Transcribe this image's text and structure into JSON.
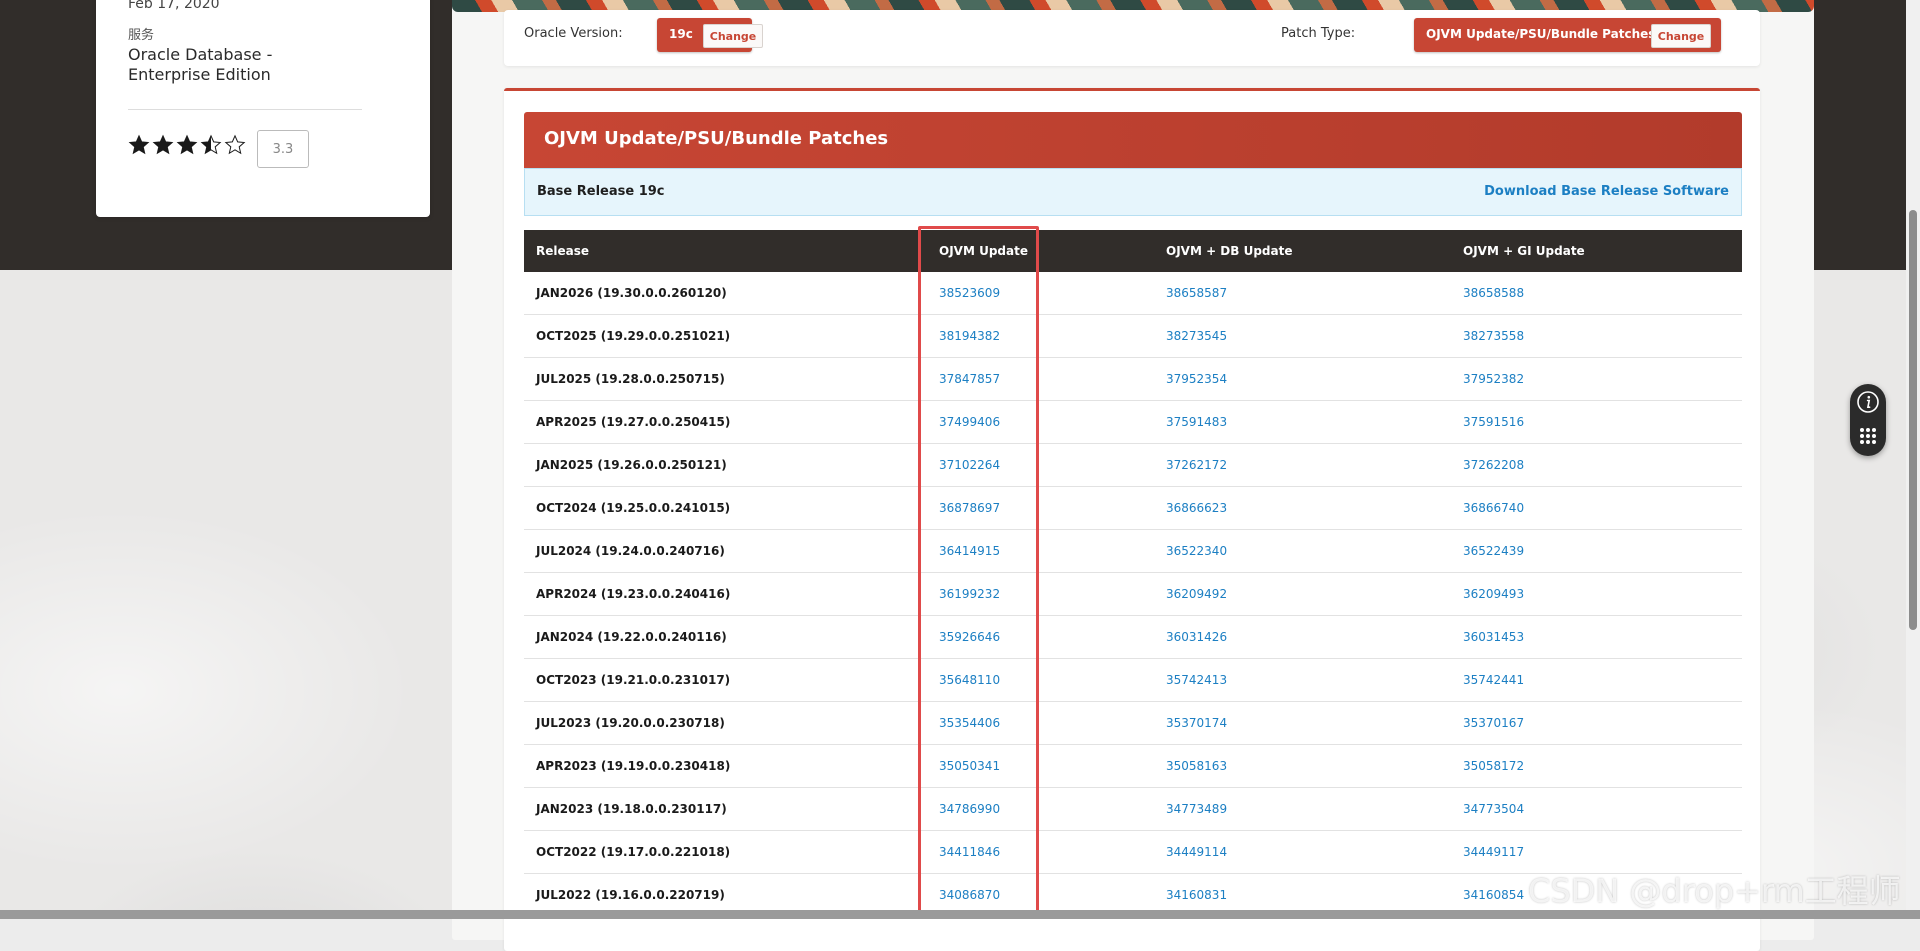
{
  "sidebar_card": {
    "date": "Feb 17, 2020",
    "service_label": "服务",
    "service_value": "Oracle Database - Enterprise Edition",
    "rating_value": 3.5,
    "rating_display": "3.3"
  },
  "selector": {
    "version_label": "Oracle Version:",
    "version_value": "19c",
    "patch_type_label": "Patch Type:",
    "patch_type_value": "OJVM Update/PSU/Bundle Patches",
    "change_label": "Change"
  },
  "section": {
    "title": "OJVM Update/PSU/Bundle Patches",
    "base_release": "Base Release 19c",
    "download_link": "Download Base Release Software"
  },
  "table": {
    "headers": [
      "Release",
      "OJVM Update",
      "OJVM + DB Update",
      "OJVM + GI Update"
    ],
    "rows": [
      [
        "JAN2026 (19.30.0.0.260120)",
        "38523609",
        "38658587",
        "38658588"
      ],
      [
        "OCT2025 (19.29.0.0.251021)",
        "38194382",
        "38273545",
        "38273558"
      ],
      [
        "JUL2025 (19.28.0.0.250715)",
        "37847857",
        "37952354",
        "37952382"
      ],
      [
        "APR2025 (19.27.0.0.250415)",
        "37499406",
        "37591483",
        "37591516"
      ],
      [
        "JAN2025 (19.26.0.0.250121)",
        "37102264",
        "37262172",
        "37262208"
      ],
      [
        "OCT2024 (19.25.0.0.241015)",
        "36878697",
        "36866623",
        "36866740"
      ],
      [
        "JUL2024 (19.24.0.0.240716)",
        "36414915",
        "36522340",
        "36522439"
      ],
      [
        "APR2024 (19.23.0.0.240416)",
        "36199232",
        "36209492",
        "36209493"
      ],
      [
        "JAN2024 (19.22.0.0.240116)",
        "35926646",
        "36031426",
        "36031453"
      ],
      [
        "OCT2023 (19.21.0.0.231017)",
        "35648110",
        "35742413",
        "35742441"
      ],
      [
        "JUL2023 (19.20.0.0.230718)",
        "35354406",
        "35370174",
        "35370167"
      ],
      [
        "APR2023 (19.19.0.0.230418)",
        "35050341",
        "35058163",
        "35058172"
      ],
      [
        "JAN2023 (19.18.0.0.230117)",
        "34786990",
        "34773489",
        "34773504"
      ],
      [
        "OCT2022 (19.17.0.0.221018)",
        "34411846",
        "34449114",
        "34449117"
      ],
      [
        "JUL2022 (19.16.0.0.220719)",
        "34086870",
        "34160831",
        "34160854"
      ]
    ]
  },
  "icons": {
    "info": "info-icon",
    "grid": "grid-menu-icon"
  },
  "colors": {
    "accent": "#c74634",
    "link": "#1c7fc3",
    "header_dark": "#312d2a",
    "highlight": "#e04a4a"
  },
  "watermark": "CSDN @drop+rm工程师"
}
